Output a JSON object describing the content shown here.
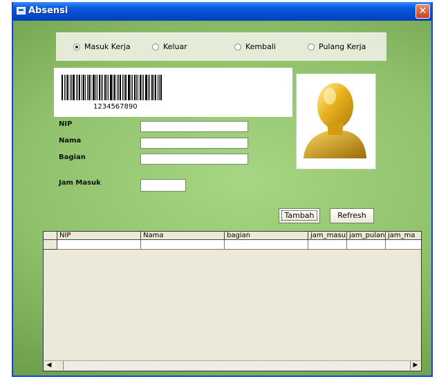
{
  "window": {
    "title": "Absensi",
    "close_symbol": "✕",
    "icon": "app-window-icon"
  },
  "radios": [
    {
      "label": "Masuk Kerja",
      "selected": true
    },
    {
      "label": "Keluar",
      "selected": false
    },
    {
      "label": "Kembali",
      "selected": false
    },
    {
      "label": "Pulang Kerja",
      "selected": false
    }
  ],
  "barcode": {
    "text": "1234567890"
  },
  "form": {
    "nip_label": "NIP",
    "nama_label": "Nama",
    "bagian_label": "Bagian",
    "jam_masuk_label": "Jam Masuk",
    "nip_value": "",
    "nama_value": "",
    "bagian_value": "",
    "jam_masuk_value": ""
  },
  "photo": {
    "icon": "user-avatar-icon"
  },
  "buttons": {
    "tambah": "Tambah",
    "refresh": "Refresh"
  },
  "grid": {
    "columns": [
      "NIP",
      "Nama",
      "bagian",
      "jam_masuk",
      "jam_pulang",
      "jam_ma"
    ],
    "rows": [
      [
        "",
        "",
        "",
        "",
        "",
        ""
      ]
    ]
  },
  "colors": {
    "titlebar": "#0a5be0",
    "close_button": "#d8532f",
    "background_green": "#8fc06a"
  }
}
